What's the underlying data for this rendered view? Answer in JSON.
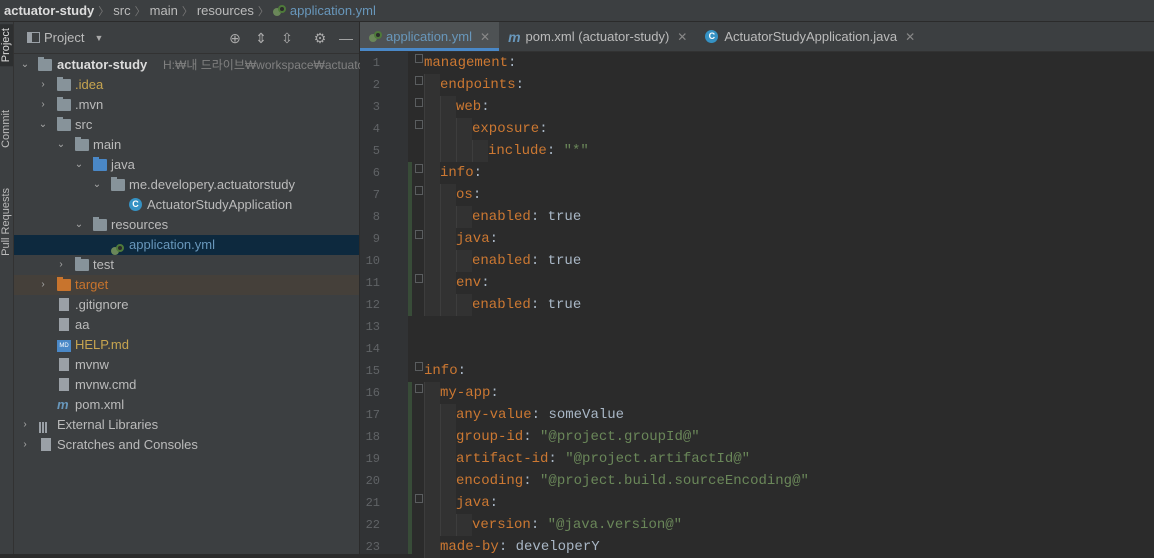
{
  "breadcrumb": {
    "items": [
      "actuator-study",
      "src",
      "main",
      "resources",
      "application.yml"
    ]
  },
  "sidestrip": {
    "tabs": [
      "Project",
      "Commit",
      "Pull Requests"
    ]
  },
  "project_panel": {
    "title": "Project",
    "tree": [
      {
        "label": "actuator-study",
        "path": "H:₩내 드라이브₩workspace₩actuator-s",
        "icon": "module-folder-icon",
        "expanded": true,
        "level": 0
      },
      {
        "label": ".idea",
        "icon": "folder-icon",
        "expanded": false,
        "level": 1,
        "color": "#c7a550"
      },
      {
        "label": ".mvn",
        "icon": "folder-icon",
        "expanded": false,
        "level": 1
      },
      {
        "label": "src",
        "icon": "folder-icon",
        "expanded": true,
        "level": 1
      },
      {
        "label": "main",
        "icon": "folder-icon",
        "expanded": true,
        "level": 2
      },
      {
        "label": "java",
        "icon": "source-folder-icon",
        "expanded": true,
        "level": 3
      },
      {
        "label": "me.developery.actuatorstudy",
        "icon": "package-icon",
        "expanded": true,
        "level": 4
      },
      {
        "label": "ActuatorStudyApplication",
        "icon": "spring-class-icon",
        "level": 5
      },
      {
        "label": "resources",
        "icon": "resources-folder-icon",
        "expanded": true,
        "level": 3
      },
      {
        "label": "application.yml",
        "icon": "yaml-icon",
        "level": 4,
        "selected": true
      },
      {
        "label": "test",
        "icon": "folder-icon",
        "expanded": false,
        "level": 2
      },
      {
        "label": "target",
        "icon": "excluded-folder-icon",
        "expanded": false,
        "level": 1,
        "color": "#c8742d"
      },
      {
        "label": ".gitignore",
        "icon": "gitignore-icon",
        "level": 1
      },
      {
        "label": "aa",
        "icon": "file-icon",
        "level": 1
      },
      {
        "label": "HELP.md",
        "icon": "markdown-icon",
        "level": 1,
        "color": "#c7a550"
      },
      {
        "label": "mvnw",
        "icon": "file-icon",
        "level": 1
      },
      {
        "label": "mvnw.cmd",
        "icon": "file-icon",
        "level": 1
      },
      {
        "label": "pom.xml",
        "icon": "maven-icon",
        "level": 1
      },
      {
        "label": "External Libraries",
        "icon": "libraries-icon",
        "expanded": false,
        "level": 0
      },
      {
        "label": "Scratches and Consoles",
        "icon": "scratches-icon",
        "expanded": false,
        "level": 0
      }
    ]
  },
  "editor": {
    "tabs": [
      {
        "label": "application.yml",
        "icon": "yaml-icon",
        "active": true,
        "closable": true
      },
      {
        "label": "pom.xml (actuator-study)",
        "icon": "maven-icon",
        "active": false,
        "closable": true
      },
      {
        "label": "ActuatorStudyApplication.java",
        "icon": "spring-class-icon",
        "active": false,
        "closable": true
      }
    ],
    "lines": [
      {
        "n": "1",
        "indent": 0,
        "key": "management",
        "sep": ":",
        "value": ""
      },
      {
        "n": "2",
        "indent": 1,
        "key": "endpoints",
        "sep": ":",
        "value": ""
      },
      {
        "n": "3",
        "indent": 2,
        "key": "web",
        "sep": ":",
        "value": ""
      },
      {
        "n": "4",
        "indent": 3,
        "key": "exposure",
        "sep": ":",
        "value": ""
      },
      {
        "n": "5",
        "indent": 4,
        "key": "include",
        "sep": ": ",
        "value": "\"*\"",
        "vtype": "string"
      },
      {
        "n": "6",
        "indent": 1,
        "key": "info",
        "sep": ":",
        "value": ""
      },
      {
        "n": "7",
        "indent": 2,
        "key": "os",
        "sep": ":",
        "value": ""
      },
      {
        "n": "8",
        "indent": 3,
        "key": "enabled",
        "sep": ": ",
        "value": "true",
        "vtype": "plain"
      },
      {
        "n": "9",
        "indent": 2,
        "key": "java",
        "sep": ":",
        "value": ""
      },
      {
        "n": "10",
        "indent": 3,
        "key": "enabled",
        "sep": ": ",
        "value": "true",
        "vtype": "plain"
      },
      {
        "n": "11",
        "indent": 2,
        "key": "env",
        "sep": ":",
        "value": ""
      },
      {
        "n": "12",
        "indent": 3,
        "key": "enabled",
        "sep": ": ",
        "value": "true",
        "vtype": "plain"
      },
      {
        "n": "13",
        "indent": 0,
        "key": "",
        "sep": "",
        "value": ""
      },
      {
        "n": "14",
        "indent": 0,
        "key": "",
        "sep": "",
        "value": ""
      },
      {
        "n": "15",
        "indent": 0,
        "key": "info",
        "sep": ":",
        "value": ""
      },
      {
        "n": "16",
        "indent": 1,
        "key": "my-app",
        "sep": ":",
        "value": ""
      },
      {
        "n": "17",
        "indent": 2,
        "key": "any-value",
        "sep": ": ",
        "value": "someValue",
        "vtype": "plain"
      },
      {
        "n": "18",
        "indent": 2,
        "key": "group-id",
        "sep": ": ",
        "value": "\"@project.groupId@\"",
        "vtype": "string"
      },
      {
        "n": "19",
        "indent": 2,
        "key": "artifact-id",
        "sep": ": ",
        "value": "\"@project.artifactId@\"",
        "vtype": "string"
      },
      {
        "n": "20",
        "indent": 2,
        "key": "encoding",
        "sep": ": ",
        "value": "\"@project.build.sourceEncoding@\"",
        "vtype": "string"
      },
      {
        "n": "21",
        "indent": 2,
        "key": "java",
        "sep": ":",
        "value": ""
      },
      {
        "n": "22",
        "indent": 3,
        "key": "version",
        "sep": ": ",
        "value": "\"@java.version@\"",
        "vtype": "string"
      },
      {
        "n": "23",
        "indent": 1,
        "key": "made-by",
        "sep": ": ",
        "value": "developerY",
        "vtype": "plain"
      }
    ]
  },
  "colors": {
    "key": "#cc7832",
    "string": "#6a8759",
    "plain": "#a9b7c6",
    "selection": "#0d293e",
    "accent": "#4a88c7"
  }
}
